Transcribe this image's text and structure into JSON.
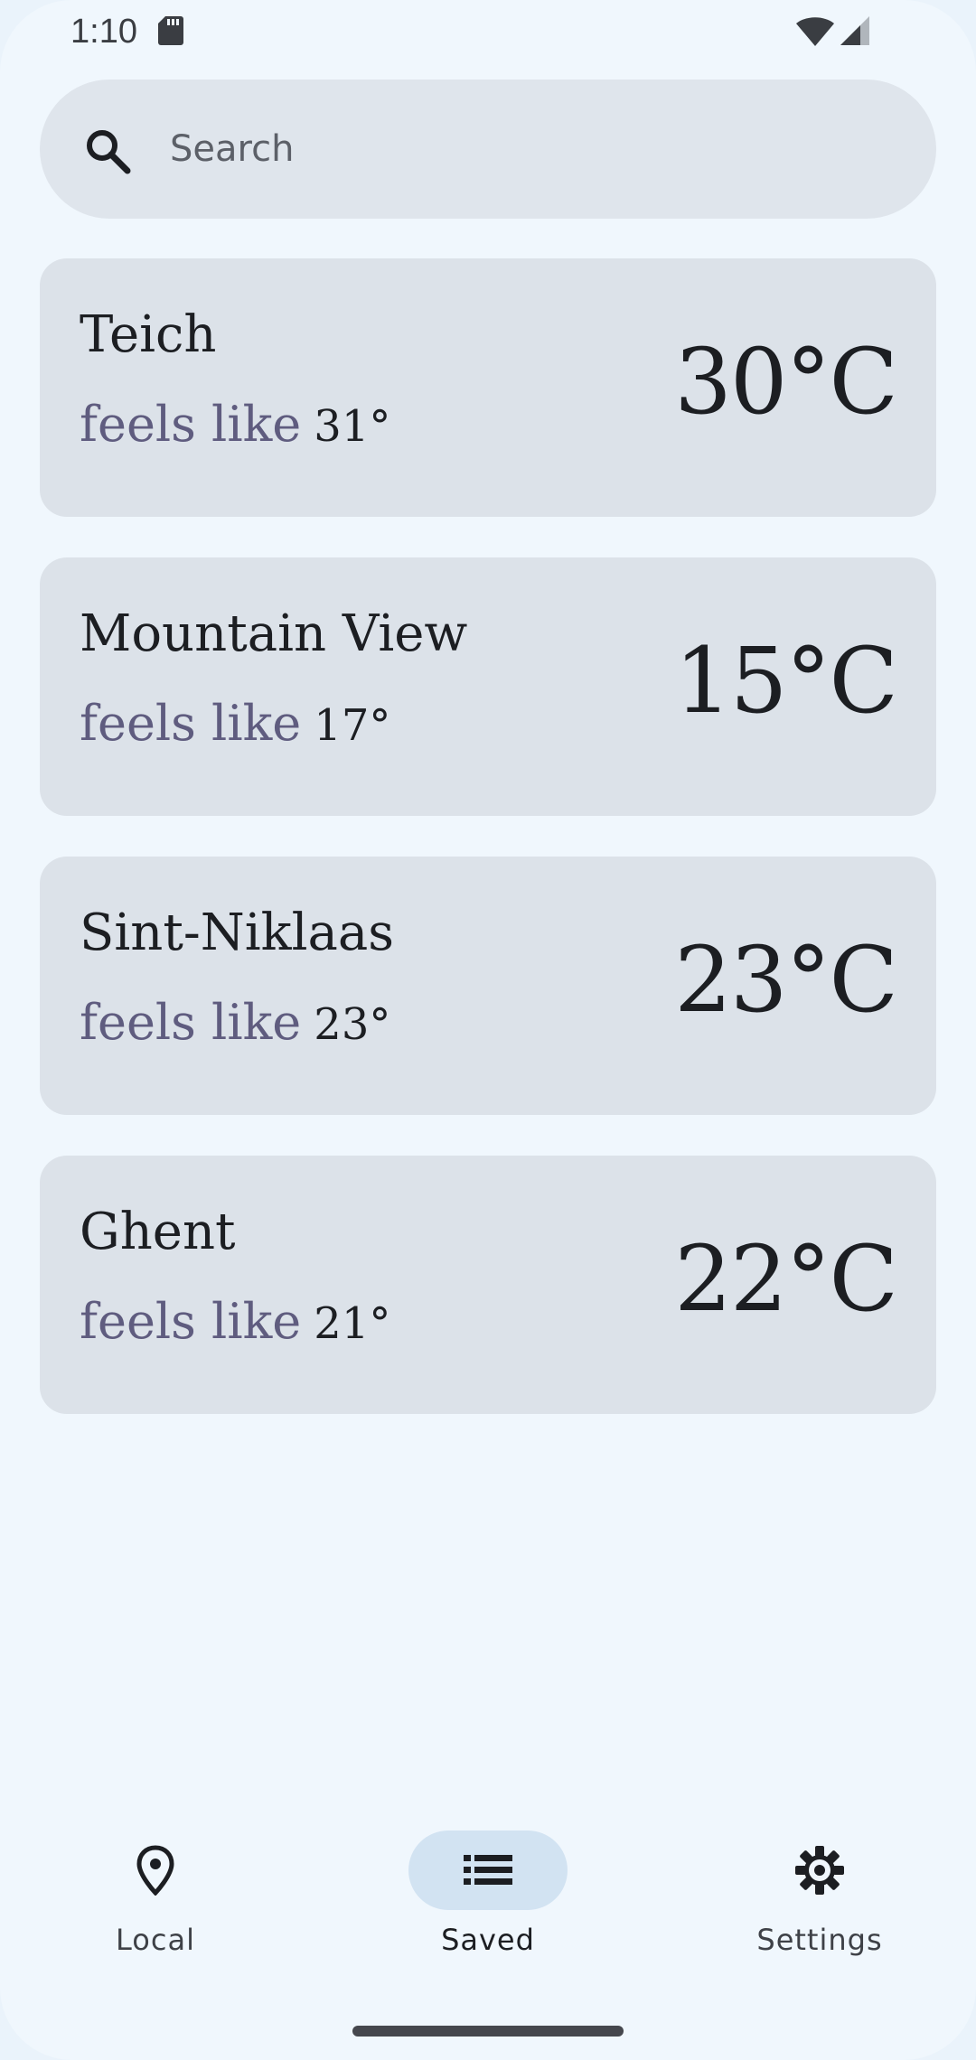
{
  "status_bar": {
    "time": "1:10"
  },
  "search": {
    "placeholder": "Search",
    "value": ""
  },
  "cities": [
    {
      "name": "Teich",
      "feels_prefix": "feels like",
      "feels_value": "31°",
      "temperature": "30°C"
    },
    {
      "name": "Mountain View",
      "feels_prefix": "feels like",
      "feels_value": "17°",
      "temperature": "15°C"
    },
    {
      "name": "Sint-Niklaas",
      "feels_prefix": "feels like",
      "feels_value": "23°",
      "temperature": "23°C"
    },
    {
      "name": "Ghent",
      "feels_prefix": "feels like",
      "feels_value": "21°",
      "temperature": "22°C"
    }
  ],
  "nav": {
    "items": [
      {
        "label": "Local",
        "icon": "location-pin-icon",
        "active": false
      },
      {
        "label": "Saved",
        "icon": "list-icon",
        "active": true
      },
      {
        "label": "Settings",
        "icon": "gear-icon",
        "active": false
      }
    ]
  },
  "colors": {
    "background": "#f0f7fd",
    "card": "#dce2e9",
    "search_bar": "#dfe5ec",
    "feels_text": "#5f5c7f",
    "nav_active_pill": "#d2e3f2"
  }
}
